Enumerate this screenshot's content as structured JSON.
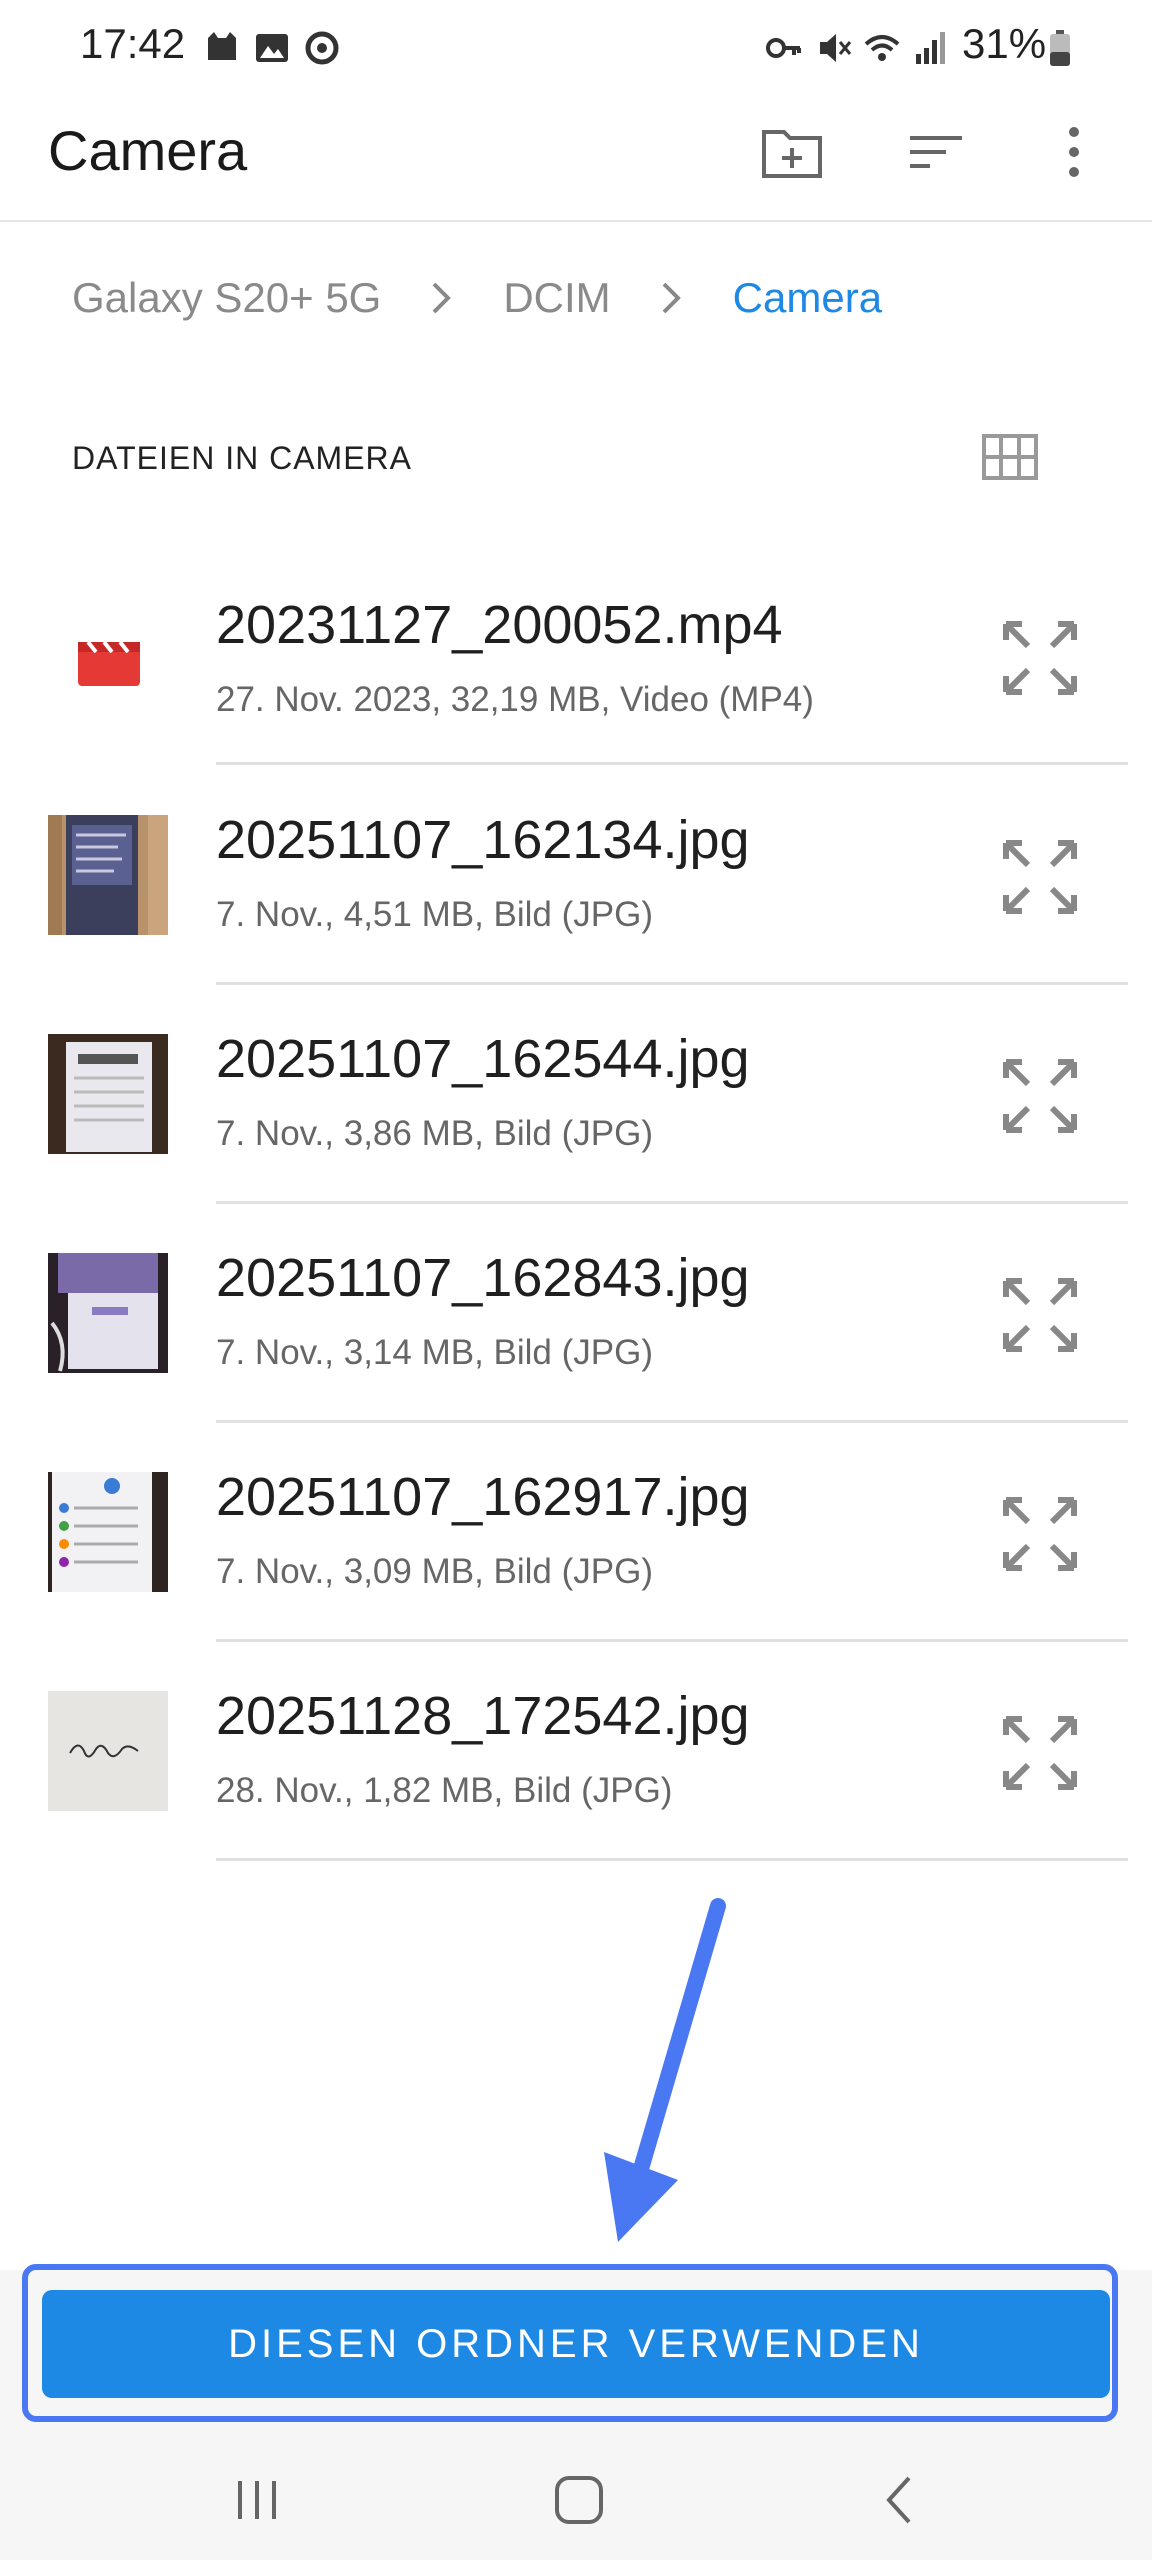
{
  "status_bar": {
    "time": "17:42",
    "battery": "31%"
  },
  "app_bar": {
    "title": "Camera",
    "icons": [
      "new-folder-icon",
      "sort-icon",
      "more-vert-icon"
    ]
  },
  "breadcrumb": [
    "Galaxy S20+ 5G",
    "DCIM",
    "Camera"
  ],
  "section": {
    "title": "DATEIEN IN CAMERA"
  },
  "files": [
    {
      "name": "20231127_200052.mp4",
      "meta": "27. Nov. 2023, 32,19 MB, Video (MP4)",
      "type": "video"
    },
    {
      "name": "20251107_162134.jpg",
      "meta": "7. Nov., 4,51 MB, Bild (JPG)",
      "type": "image"
    },
    {
      "name": "20251107_162544.jpg",
      "meta": "7. Nov., 3,86 MB, Bild (JPG)",
      "type": "image"
    },
    {
      "name": "20251107_162843.jpg",
      "meta": "7. Nov., 3,14 MB, Bild (JPG)",
      "type": "image"
    },
    {
      "name": "20251107_162917.jpg",
      "meta": "7. Nov., 3,09 MB, Bild (JPG)",
      "type": "image"
    },
    {
      "name": "20251128_172542.jpg",
      "meta": "28. Nov., 1,82 MB, Bild (JPG)",
      "type": "image"
    }
  ],
  "action_button": {
    "label": "DIESEN ORDNER VERWENDEN"
  },
  "colors": {
    "accent": "#1e88e5",
    "highlight": "#4a78f2",
    "video_icon": "#e53935"
  }
}
